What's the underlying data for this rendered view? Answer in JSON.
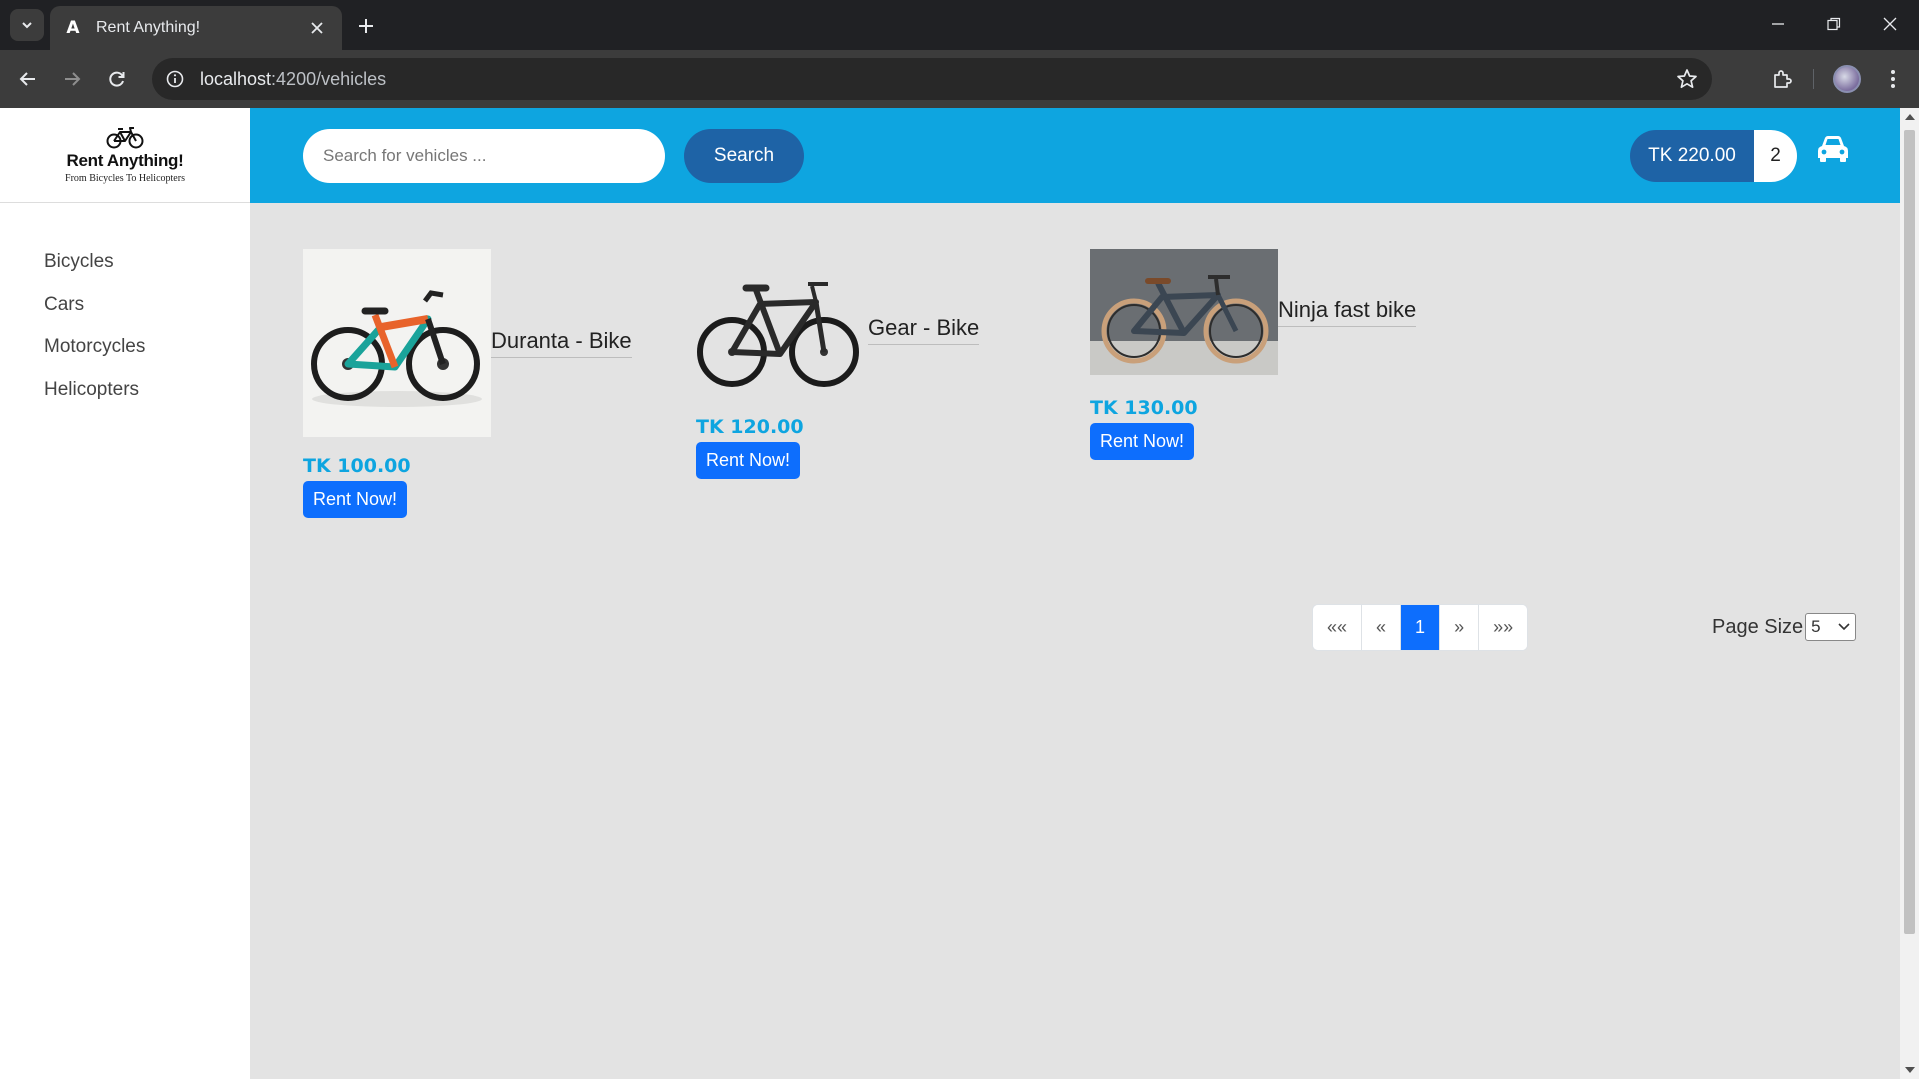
{
  "browser": {
    "tab_title": "Rent Anything!",
    "tab_favicon": "A",
    "url_host": "localhost",
    "url_path": ":4200/vehicles"
  },
  "logo": {
    "title": "Rent Anything!",
    "subtitle": "From Bicycles To Helicopters"
  },
  "sidebar": {
    "items": [
      {
        "label": "Bicycles"
      },
      {
        "label": "Cars"
      },
      {
        "label": "Motorcycles"
      },
      {
        "label": "Helicopters"
      }
    ]
  },
  "header": {
    "search_placeholder": "Search for vehicles ...",
    "search_label": "Search",
    "cart_total": "TK 220.00",
    "cart_quantity": "2",
    "cart_icon": "car-icon"
  },
  "products": [
    {
      "name": "Duranta - Bike",
      "price": "TK 100.00",
      "button": "Rent Now!"
    },
    {
      "name": "Gear - Bike",
      "price": "TK 120.00",
      "button": "Rent Now!"
    },
    {
      "name": "Ninja fast bike",
      "price": "TK 130.00",
      "button": "Rent Now!"
    }
  ],
  "pagination": {
    "first": "««",
    "prev": "«",
    "current": "1",
    "next": "»",
    "last": "»»"
  },
  "page_size": {
    "label": "Page Size",
    "value": "5"
  },
  "colors": {
    "header_bg": "#0ea5e0",
    "primary_button": "#0d6efd",
    "dark_blue": "#1e63a6",
    "price": "#0ea5e0"
  }
}
